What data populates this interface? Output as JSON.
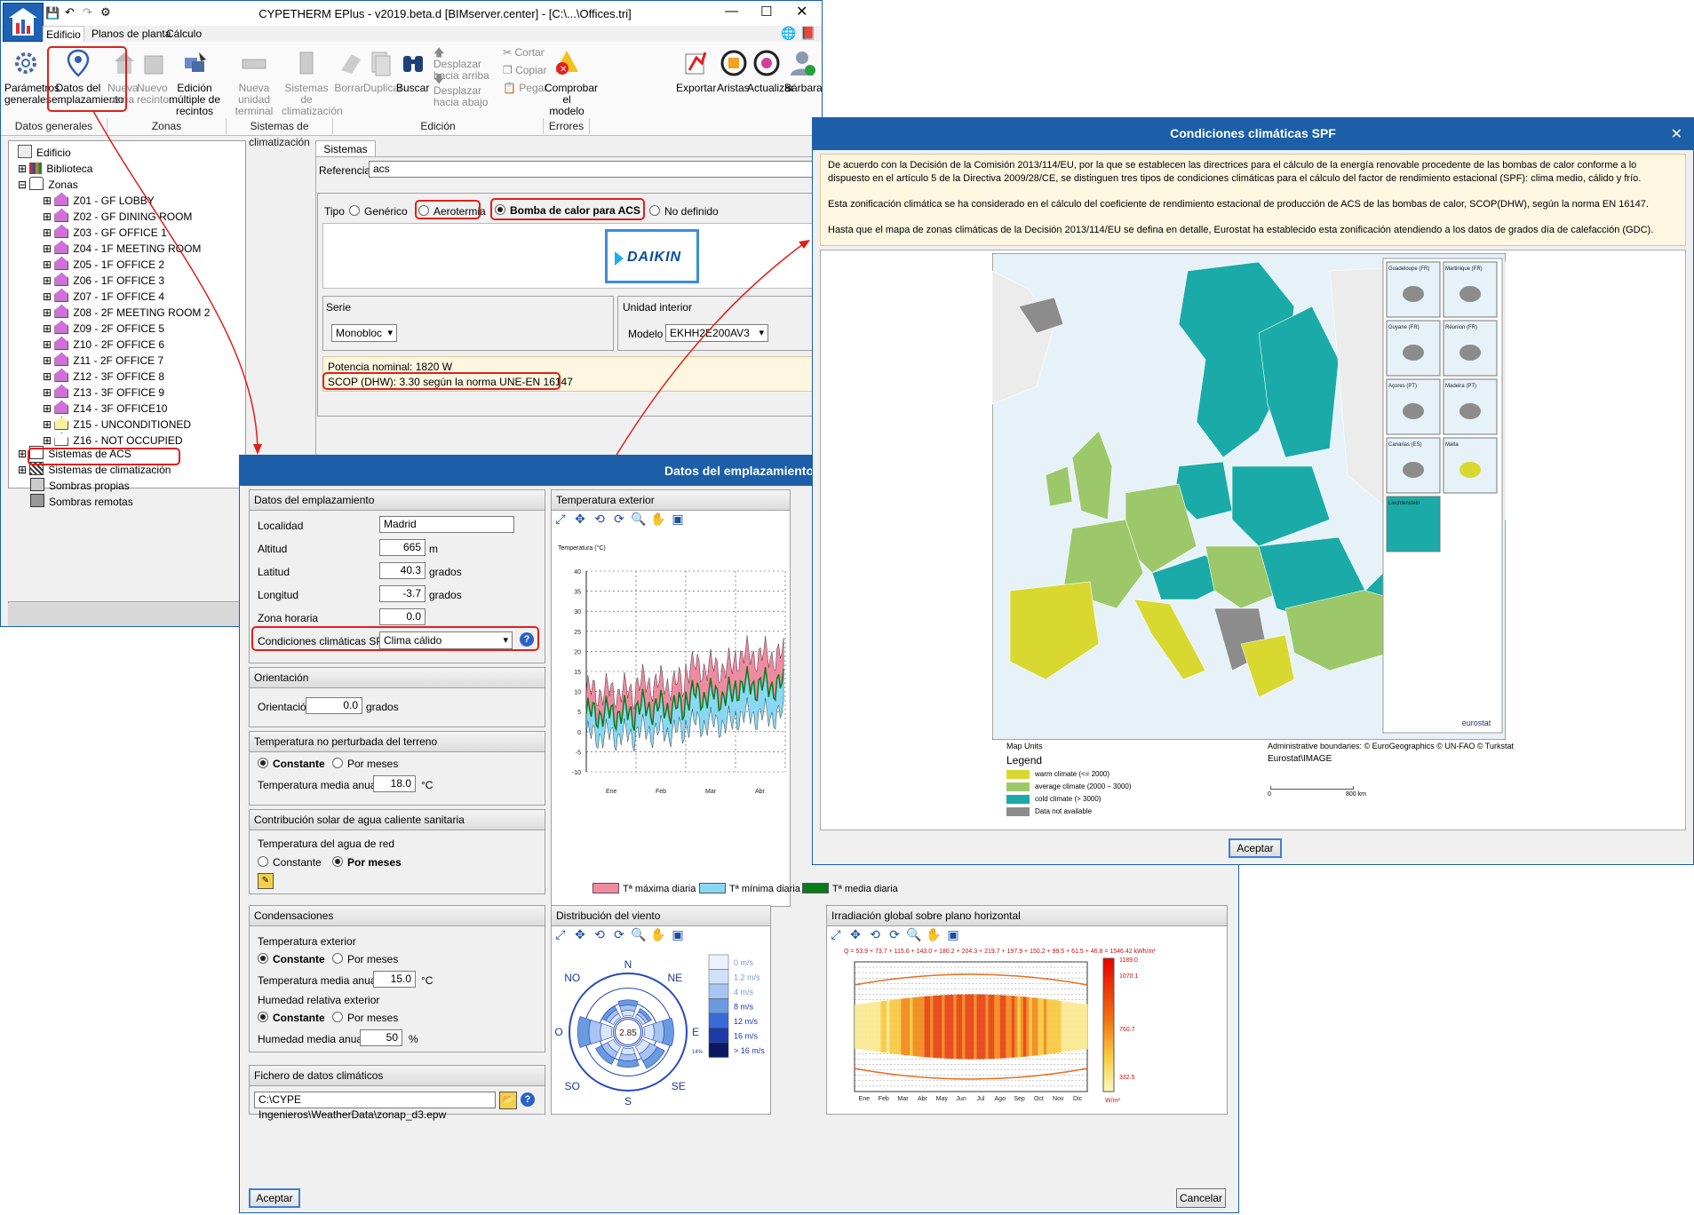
{
  "main_window": {
    "title": "CYPETHERM EPlus - v2019.beta.d [BIMserver.center] - [C:\\...\\Offices.tri]",
    "menu_tabs": [
      "Edificio",
      "Planos de planta",
      "Cálculo"
    ],
    "toolbar": {
      "parametros": "Parámetros generales",
      "datos_emplazamiento": "Datos del emplazamiento",
      "nueva_zona": "Nueva zona",
      "nuevo_recinto": "Nuevo recinto",
      "edicion_multiple": "Edición múltiple de recintos",
      "nueva_unidad": "Nueva unidad terminal",
      "sistemas_clim": "Sistemas de climatización",
      "borrar": "Borrar",
      "duplicar": "Duplicar",
      "buscar": "Buscar",
      "desplazar_arriba": "Desplazar hacia arriba",
      "desplazar_abajo": "Desplazar hacia abajo",
      "cortar": "Cortar",
      "copiar": "Copiar",
      "pegar": "Pegar",
      "comprobar": "Comprobar el modelo",
      "exportar": "Exportar",
      "aristas": "Aristas",
      "actualizar": "Actualizar",
      "barbara": "Bárbara"
    },
    "groups": [
      "Datos generales",
      "Zonas",
      "Sistemas de climatización",
      "Edición",
      "Errores"
    ],
    "tree": {
      "edificio": "Edificio",
      "biblioteca": "Biblioteca",
      "zonas": "Zonas",
      "zone_items": [
        "Z01 - GF LOBBY",
        "Z02 - GF DINING ROOM",
        "Z03 - GF OFFICE 1",
        "Z04 - 1F MEETING ROOM",
        "Z05 - 1F OFFICE 2",
        "Z06 - 1F OFFICE 3",
        "Z07 - 1F OFFICE 4",
        "Z08 - 2F MEETING ROOM 2",
        "Z09 - 2F OFFICE 5",
        "Z10 - 2F OFFICE 6",
        "Z11 - 2F OFFICE 7",
        "Z12 - 3F OFFICE 8",
        "Z13 - 3F OFFICE 9",
        "Z14 - 3F OFFICE10",
        "Z15 - UNCONDITIONED",
        "Z16 - NOT OCCUPIED"
      ],
      "sistemas_acs": "Sistemas de ACS",
      "sistemas_clim": "Sistemas de climatización",
      "sombras_propias": "Sombras propias",
      "sombras_remotas": "Sombras remotas"
    },
    "right": {
      "tab": "Sistemas",
      "referencia_label": "Referencia",
      "referencia_value": "acs",
      "tipo_label": "Tipo",
      "tipo_options": [
        "Genérico",
        "Aerotermia",
        "Bomba de calor para ACS",
        "No definido"
      ],
      "brand": "DAIKIN",
      "serie_title": "Serie",
      "serie_value": "Monobloc",
      "unidad_title": "Unidad interior",
      "modelo_label": "Modelo",
      "modelo_value": "EKHH2E200AV3",
      "potencia": "Potencia nominal: 1820 W",
      "scop": "SCOP (DHW): 3.30 según la norma UNE-EN 16147"
    }
  },
  "site_dialog": {
    "title": "Datos del emplazamiento",
    "datos": {
      "header": "Datos del emplazamiento",
      "localidad_label": "Localidad",
      "localidad": "Madrid",
      "altitud_label": "Altitud",
      "altitud": "665",
      "altitud_unit": "m",
      "latitud_label": "Latitud",
      "latitud": "40.3",
      "latitud_unit": "grados",
      "longitud_label": "Longitud",
      "longitud": "-3.7",
      "longitud_unit": "grados",
      "zona_label": "Zona horaria",
      "zona": "0.0",
      "spf_label": "Condiciones climáticas SPF",
      "spf_value": "Clima cálido"
    },
    "orientacion": {
      "header": "Orientación",
      "label": "Orientación",
      "value": "0.0",
      "unit": "grados"
    },
    "terreno": {
      "header": "Temperatura no perturbada del terreno",
      "opt_constante": "Constante",
      "opt_meses": "Por meses",
      "media_label": "Temperatura media anual:",
      "media": "18.0",
      "unit": "°C"
    },
    "solar": {
      "header": "Contribución solar de agua caliente sanitaria",
      "agua_label": "Temperatura del agua de red",
      "opt_constante": "Constante",
      "opt_meses": "Por meses"
    },
    "condens": {
      "header": "Condensaciones",
      "temp_ext": "Temperatura exterior",
      "opt_constante": "Constante",
      "opt_meses": "Por meses",
      "temp_media_label": "Temperatura media anual:",
      "temp_media": "15.0",
      "temp_unit": "°C",
      "hum_label": "Humedad relativa exterior",
      "opt_constante2": "Constante",
      "opt_meses2": "Por meses",
      "hum_media_label": "Humedad media anual:",
      "hum_media": "50",
      "hum_unit": "%"
    },
    "fichero": {
      "header": "Fichero de datos climáticos",
      "path": "C:\\CYPE Ingenieros\\WeatherData\\zonap_d3.epw"
    },
    "temp_panel": "Temperatura exterior",
    "viento_panel": "Distribución del viento",
    "irr_panel": "Irradiación global sobre plano horizontal",
    "aceptar": "Aceptar",
    "cancelar": "Cancelar"
  },
  "chart_data": [
    {
      "type": "line",
      "title": "Temperatura (°C)",
      "yticks": [
        40,
        35,
        30,
        25,
        20,
        15,
        10,
        5,
        0,
        -5,
        -10
      ],
      "ylim": [
        -10,
        40
      ],
      "categories": [
        "Ene",
        "Feb",
        "Mar",
        "Abr"
      ],
      "series": [
        {
          "name": "Tª máxima diaria",
          "color": "#f08aa0",
          "values": [
            10,
            12,
            16,
            19
          ]
        },
        {
          "name": "Tª mínima diaria",
          "color": "#88d8f4",
          "values": [
            1,
            2,
            4,
            6
          ]
        },
        {
          "name": "Tª media diaria",
          "color": "#0a7a1a",
          "values": [
            5,
            7,
            10,
            12
          ]
        }
      ]
    },
    {
      "type": "other",
      "directions": [
        "N",
        "NE",
        "E",
        "SE",
        "S",
        "SO",
        "O",
        "NO"
      ],
      "center_value": "2.85",
      "side_label": "14%",
      "speed_classes": [
        "0 m/s",
        "1.2 m/s",
        "4 m/s",
        "8 m/s",
        "12 m/s",
        "16 m/s",
        "> 16 m/s"
      ]
    },
    {
      "type": "heatmap",
      "monthly_sums": "Q = 53.9 + 73.7 + 115.6 + 143.0 + 180.2 + 204.3 + 219.7 + 197.9 + 150.2 + 99.5 + 61.5 + 46.8 = 1546.42 kWh/m²",
      "months": [
        "Ene",
        "Feb",
        "Mar",
        "Abr",
        "May",
        "Jun",
        "Jul",
        "Ago",
        "Sep",
        "Oct",
        "Nov",
        "Dic"
      ],
      "colorbar": [
        "1189.0",
        "1070.1",
        "760.7",
        "332.5"
      ],
      "unit": "W/m²"
    }
  ],
  "spf_dialog": {
    "title": "Condiciones climáticas SPF",
    "text1": "De acuerdo con la Decisión de la Comisión 2013/114/EU, por la que se establecen las directrices para el cálculo de la energía renovable procedente de las bombas de calor conforme a lo dispuesto en el artículo 5 de la Directiva 2009/28/CE, se distinguen tres tipos de condiciones climáticas para el cálculo del factor de rendimiento estacional (SPF): clima medio, cálido y frío.",
    "text2": "Esta zonificación climática se ha considerado en el cálculo del coeficiente de rendimiento estacional de producción de ACS de las bombas de calor, SCOP(DHW), según la norma EN 16147.",
    "text3": "Hasta que el mapa de zonas climáticas de la Decisión 2013/114/EU se defina en detalle, Eurostat ha establecido esta zonificación atendiendo a los datos de grados día de calefacción (GDC).",
    "insets": [
      "Guadeloupe (FR)",
      "Martinique (FR)",
      "Guyane (FR)",
      "Réunion (FR)",
      "Açores (PT)",
      "Madeira (PT)",
      "Canarias (ES)",
      "Malta",
      "Liechtenstein"
    ],
    "eurostat": "eurostat",
    "map_units": "Map Units",
    "legend_title": "Legend",
    "legend": [
      {
        "label": "warm climate (<= 2000)",
        "color": "#d8d830"
      },
      {
        "label": "average climate (2000 – 3000)",
        "color": "#9cc86a"
      },
      {
        "label": "cold climate (> 3000)",
        "color": "#1aaba8"
      },
      {
        "label": "Data not available",
        "color": "#8c8c8c"
      }
    ],
    "boundaries": "Administrative boundaries: © EuroGeographics © UN-FAO © Turkstat",
    "source": "Eurostat\\IMAGE",
    "scale_0": "0",
    "scale_800": "800 km",
    "aceptar": "Aceptar"
  }
}
